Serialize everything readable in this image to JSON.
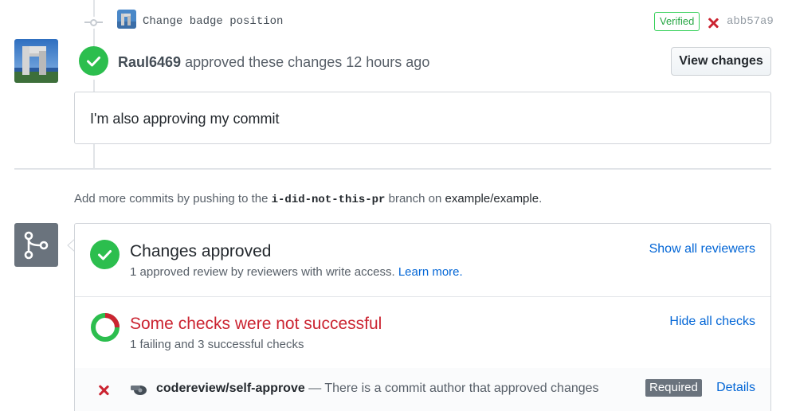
{
  "commit": {
    "message": "Change badge position",
    "verified": "Verified",
    "sha": "abb57a9"
  },
  "review": {
    "author": "Raul6469",
    "action": "approved these changes",
    "time": "12 hours ago",
    "view_button": "View changes",
    "comment": "I'm also approving my commit"
  },
  "push_note": {
    "prefix": "Add more commits by pushing to the",
    "branch": "i-did-not-this-pr",
    "middle": "branch on",
    "repo": "example/example",
    "suffix": "."
  },
  "merge": {
    "approved_title": "Changes approved",
    "approved_sub": "1 approved review by reviewers with write access.",
    "learn_more": "Learn more.",
    "show_reviewers": "Show all reviewers",
    "checks_title": "Some checks were not successful",
    "checks_sub": "1 failing and 3 successful checks",
    "hide_checks": "Hide all checks",
    "check_name": "codereview/self-approve",
    "check_desc": "— There is a commit author that approved changes",
    "required": "Required",
    "details": "Details"
  },
  "colors": {
    "success": "#2cbe4e",
    "failure": "#cb2431",
    "link": "#0366d6"
  },
  "icons": [
    "commit-icon",
    "check-icon",
    "x-icon",
    "git-merge-icon",
    "donut-status-icon",
    "whistle-icon"
  ]
}
